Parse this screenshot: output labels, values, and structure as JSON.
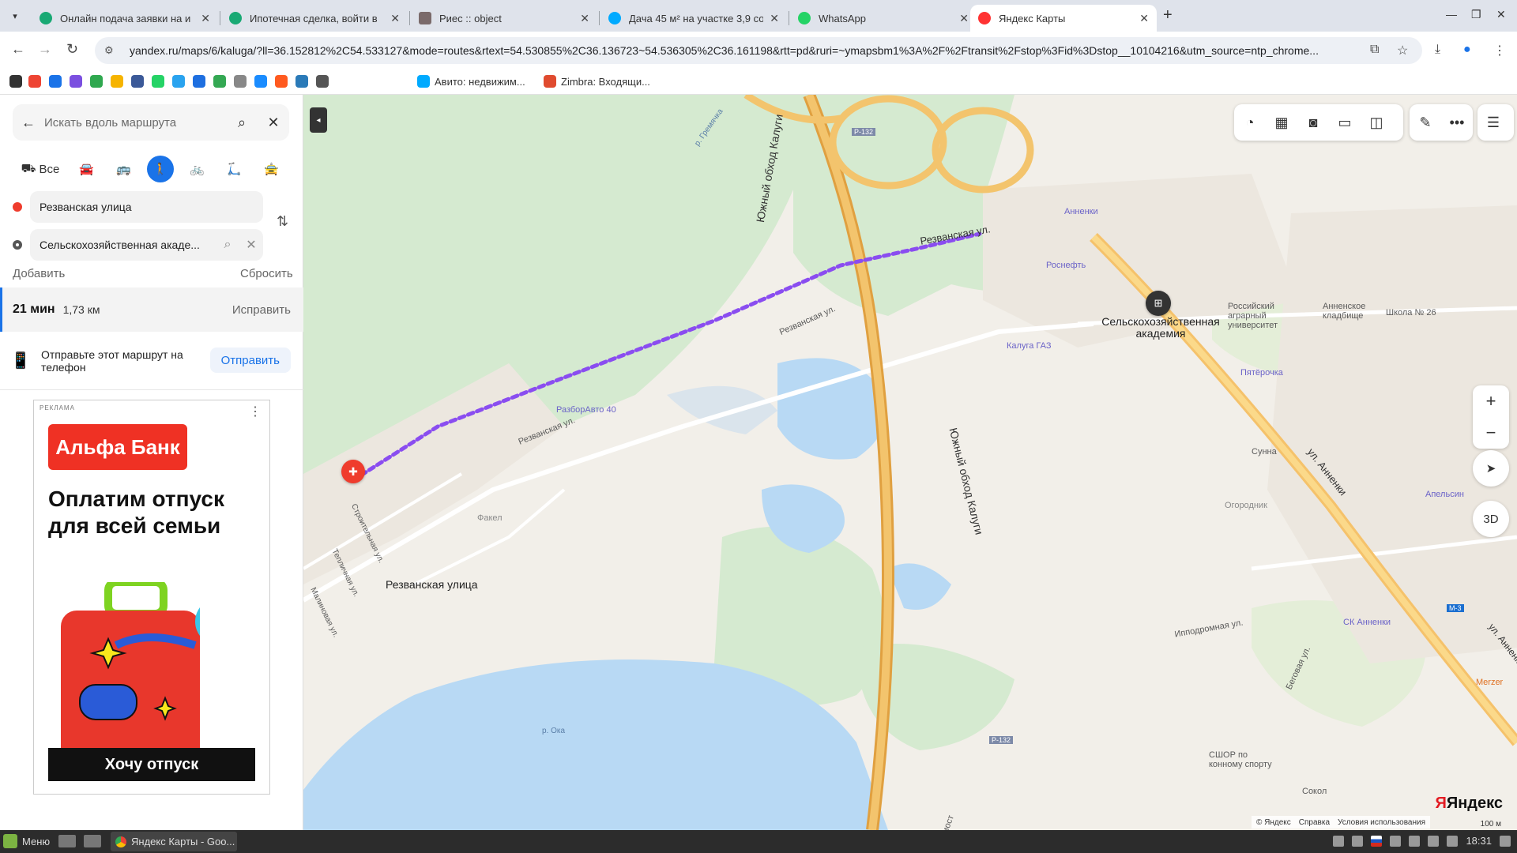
{
  "browser": {
    "tabs": [
      {
        "title": "Онлайн подача заявки на и",
        "favicon_color": "#19a974",
        "active": false
      },
      {
        "title": "Ипотечная сделка, войти в",
        "favicon_color": "#19a974",
        "active": false
      },
      {
        "title": "Риес :: object",
        "favicon_color": "#7a6a6a",
        "active": false
      },
      {
        "title": "Дача 45 м² на участке 3,9 со",
        "favicon_color": "#00aaff",
        "active": false
      },
      {
        "title": "WhatsApp",
        "favicon_color": "#25d366",
        "active": false
      },
      {
        "title": "Яндекс Карты",
        "favicon_color": "#ff3333",
        "active": true
      }
    ],
    "new_tab_symbol": "+",
    "url": "yandex.ru/maps/6/kaluga/?ll=36.152812%2C54.533127&mode=routes&rtext=54.530855%2C36.136723~54.536305%2C36.161198&rtt=pd&ruri=~ymapsbm1%3A%2F%2Ftransit%2Fstop%3Fid%3Dstop__10104216&utm_source=ntp_chrome...",
    "bookmarks": [
      {
        "label": "Авито: недвижим...",
        "color": "#00aaff"
      },
      {
        "label": "Zimbra: Входящи...",
        "color": "#e04b2f"
      }
    ],
    "bookmark_icon_colors": [
      "#333333",
      "#e43",
      "#1a73e8",
      "#7b4fe0",
      "#2fa84f",
      "#f6b400",
      "#3b5998",
      "#25d366",
      "#2aa3ef",
      "#1e6fe0",
      "#34a853",
      "#888888",
      "#1a8cff",
      "#ff5a1f",
      "#2a7ab8",
      "#555555"
    ]
  },
  "sidebar": {
    "search_placeholder": "Искать вдоль маршрута",
    "modes": {
      "all_label": "Все"
    },
    "route": {
      "from": "Резванская улица",
      "to": "Сельскохозяйственная акаде...",
      "add_label": "Добавить",
      "reset_label": "Сбросить"
    },
    "result": {
      "time": "21 мин",
      "distance": "1,73 км",
      "fix_label": "Исправить"
    },
    "send": {
      "text": "Отправьте этот маршрут на телефон",
      "button": "Отправить"
    },
    "ad": {
      "label": "РЕКЛАМА",
      "brand": "Альфа Банк",
      "headline": "Оплатим отпуск для всей семьи",
      "cta": "Хочу отпуск"
    }
  },
  "map": {
    "labels": {
      "start": "Резванская улица",
      "end": "Сельскохозяйственная академия",
      "road_south": "Южный обход Калуги",
      "road_rezv": "Резванская ул.",
      "street_annenki": "ул. Анненки",
      "r132": "Р-132",
      "m3": "М-3",
      "annenki": "Анненки",
      "rosneft": "Роснефть",
      "kaluga_gaz": "Калуга ГАЗ",
      "razbor": "РазборАвто 40",
      "fakel": "Факел",
      "univ": "Российский аграрный университет",
      "cemetery": "Анненское кладбище",
      "school": "Школа № 26",
      "pyaterochka": "Пятёрочка",
      "sunna": "Сунна",
      "ogorodnik": "Огородник",
      "apelsin": "Апельсин",
      "sk": "СК Анненки",
      "sshor": "СШОР по конному спорту",
      "sokol": "Сокол",
      "merzer": "Merzer",
      "oka": "р. Ока",
      "gremyachka": "р. Гремячка",
      "ippodrom": "Ипподромная ул.",
      "begovaya": "Беговая ул.",
      "stroitel": "Строительная ул.",
      "teplichnaya": "Тепличная ул.",
      "malinovaya": "Малиновая ул.",
      "most": "мост"
    },
    "yandex_logo": "Яндекс",
    "copyright": [
      "© Яндекс",
      "Справка",
      "Условия использования"
    ],
    "scale": "100 м",
    "btn_3d": "3D",
    "colors": {
      "route": "#8a4df0",
      "road": "#f0b24a",
      "water": "#b8d9f4",
      "green": "#cfe8c0",
      "start_pin": "#ef3c2d"
    }
  },
  "taskbar": {
    "menu_label": "Меню",
    "task_label": "Яндекс Карты - Goo...",
    "time": "18:31"
  }
}
